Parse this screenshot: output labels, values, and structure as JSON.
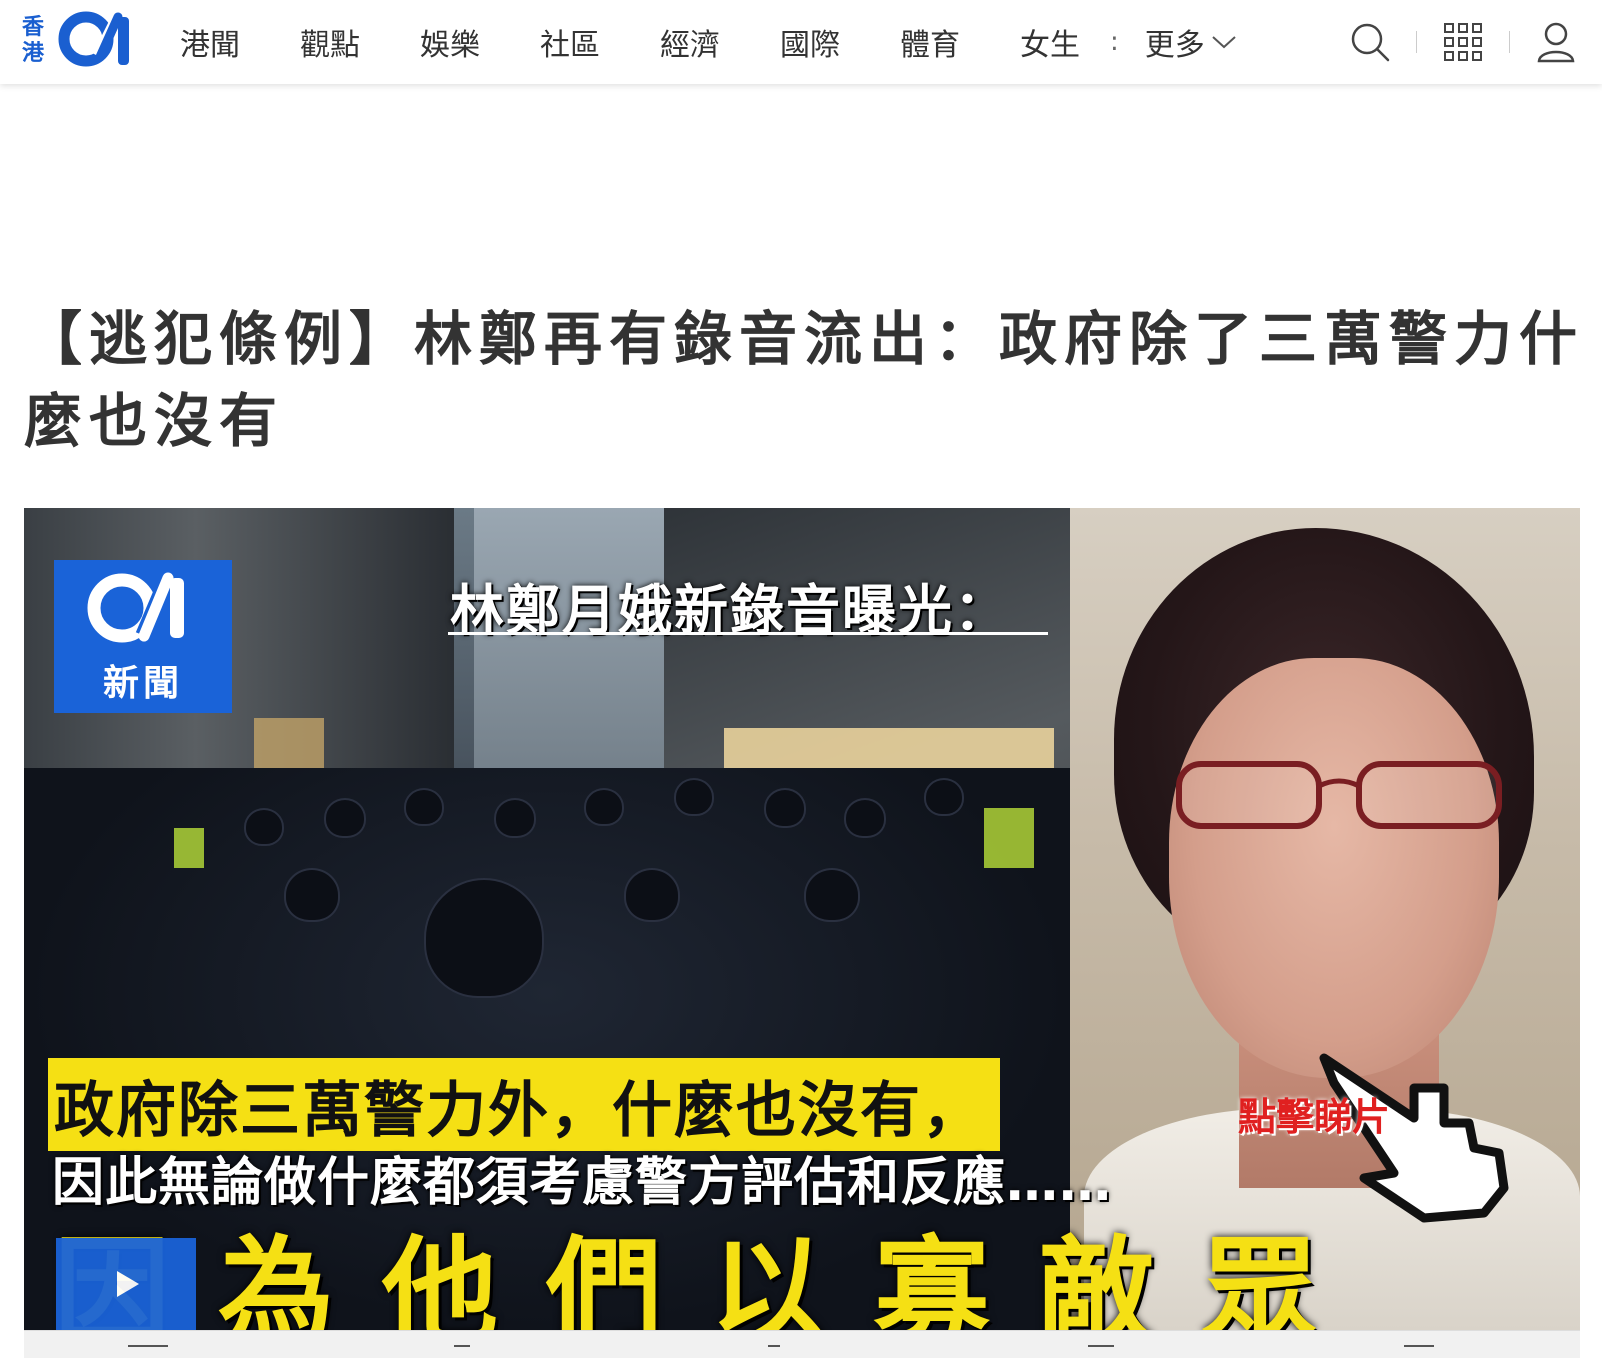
{
  "header": {
    "logo_region_line1": "香",
    "logo_region_line2": "港",
    "logo_brand": "01",
    "brand_color": "#1a5fd0",
    "nav": [
      "港聞",
      "觀點",
      "娛樂",
      "社區",
      "經濟",
      "國際",
      "體育",
      "女生"
    ],
    "nav_separator": ":",
    "more_label": "更多",
    "icons": {
      "search": "search-icon",
      "apps": "grid-icon",
      "account": "user-icon",
      "more": "chevron-down-icon"
    }
  },
  "article": {
    "headline": "【逃犯條例】林鄭再有錄音流出：政府除了三萬警力什麼也沒有"
  },
  "hero": {
    "logo_sub": "新聞",
    "caption_top": "林鄭月娥新錄音曝光：",
    "caption_yellow": "政府除三萬警力外，什麼也沒有，",
    "caption_white": "因此無論做什麼都須考慮警方評估和反應……",
    "caption_big": "因為他們以寡敵眾",
    "cta": "點擊睇片",
    "play_icon": "play-icon",
    "accent_yellow": "#f5e014",
    "accent_red": "#e02020"
  }
}
